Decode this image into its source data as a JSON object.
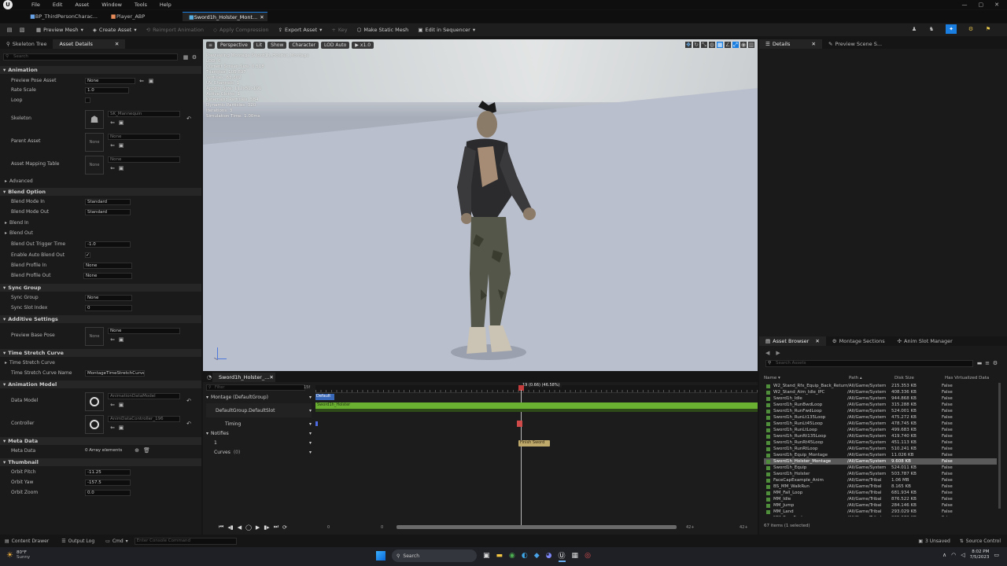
{
  "menu": [
    "File",
    "Edit",
    "Asset",
    "Window",
    "Tools",
    "Help"
  ],
  "doc_tabs": [
    {
      "label": "BP_ThirdPersonCharac...",
      "active": false
    },
    {
      "label": "Player_ABP",
      "active": false
    },
    {
      "label": "Sword1h_Holster_Mont...",
      "active": true
    }
  ],
  "toolbar": {
    "preview_mesh": "Preview Mesh",
    "create_asset": "Create Asset",
    "reimport": "Reimport Animation",
    "apply_compression": "Apply Compression",
    "export_asset": "Export Asset",
    "key": "Key",
    "make_static_mesh": "Make Static Mesh",
    "edit_in_sequencer": "Edit in Sequencer"
  },
  "left_tabs": {
    "skeleton_tree": "Skeleton Tree",
    "asset_details": "Asset Details"
  },
  "search_placeholder": "Search",
  "details": {
    "animation": "Animation",
    "preview_pose_asset": "Preview Pose Asset",
    "preview_pose_val": "None",
    "rate_scale": "Rate Scale",
    "rate_scale_val": "1.0",
    "loop": "Loop",
    "skeleton": "Skeleton",
    "skeleton_val": "SK_Mannequin",
    "parent_asset": "Parent Asset",
    "parent_val": "None",
    "parent_thumb": "None",
    "asset_mapping": "Asset Mapping Table",
    "mapping_val": "None",
    "mapping_thumb": "None",
    "advanced": "Advanced",
    "blend_option": "Blend Option",
    "blend_mode_in": "Blend Mode In",
    "blend_mode_in_val": "Standard",
    "blend_mode_out": "Blend Mode Out",
    "blend_mode_out_val": "Standard",
    "blend_in": "Blend In",
    "blend_out": "Blend Out",
    "blend_out_trigger": "Blend Out Trigger Time",
    "blend_out_trigger_val": "-1.0",
    "enable_auto_blend_out": "Enable Auto Blend Out",
    "blend_profile_in": "Blend Profile In",
    "blend_profile_in_val": "None",
    "blend_profile_out": "Blend Profile Out",
    "blend_profile_out_val": "None",
    "sync_group_hdr": "Sync Group",
    "sync_group": "Sync Group",
    "sync_group_val": "None",
    "sync_slot": "Sync Slot Index",
    "sync_slot_val": "0",
    "additive": "Additive Settings",
    "preview_base_pose": "Preview Base Pose",
    "preview_base_val": "None",
    "preview_base_thumb": "None",
    "time_stretch": "Time Stretch Curve",
    "time_stretch_sub": "Time Stretch Curve",
    "time_stretch_name": "Time Stretch Curve Name",
    "time_stretch_name_val": "MontageTimeStretchCurve",
    "anim_model": "Animation Model",
    "data_model": "Data Model",
    "data_model_val": "AnimationDataModel",
    "controller": "Controller",
    "controller_val": "AnimDataController_196",
    "meta_data_hdr": "Meta Data",
    "meta_data": "Meta Data",
    "meta_data_val": "0 Array elements",
    "thumbnail": "Thumbnail",
    "orbit_pitch": "Orbit Pitch",
    "orbit_pitch_val": "-11.25",
    "orbit_yaw": "Orbit Yaw",
    "orbit_yaw_val": "-157.5",
    "orbit_zoom": "Orbit Zoom",
    "orbit_zoom_val": "0.0"
  },
  "viewport": {
    "perspective": "Perspective",
    "lit": "Lit",
    "show": "Show",
    "character": "Character",
    "lod": "LOD Auto",
    "speed": "x1.0",
    "stats": [
      "Previewing Montage Sword1h_Holster_Montage",
      "LOD: 0",
      "Current Screen Size: 0.518",
      "Triangles: 105,897",
      "Vertices: 63,602",
      "UV Channels: 1",
      "Approx Size: 112x51x191",
      "Active Cloths: 1",
      "Kinematic Particles: 584",
      "Dynamic Particles: 320",
      "Iterations: 3",
      "Simulation Time: 1.00ms"
    ]
  },
  "right_tabs": {
    "details": "Details",
    "preview_scene": "Preview Scene S..."
  },
  "montage": {
    "tab": "Sword1h_Holster_...",
    "filter": "Filter",
    "frames_start": "15f",
    "playhead": "19 (0.66) (46.58%)",
    "track_montage": "Montage (DefaultGroup)",
    "slot": "DefaultGroup.DefaultSlot",
    "default_label": "Default",
    "clip_label": "Sword1h_Holster",
    "timing": "Timing",
    "notifies": "Notifies",
    "notify_track": "1",
    "curves": "Curves",
    "curves_count": "(0)",
    "notify_name": "Finish Sword",
    "range_start": "0",
    "range_mid": "0",
    "range_end": "42+",
    "range_end2": "42+"
  },
  "asset_browser": {
    "tabs": [
      "Asset Browser",
      "Montage Sections",
      "Anim Slot Manager"
    ],
    "search_placeholder": "Search Assets",
    "columns": [
      "Name",
      "Path",
      "Disk Size",
      "Has Virtualized Data"
    ],
    "rows": [
      {
        "name": "W2_Stand_Rfx_Equip_Back_Return",
        "path": "/All/Game/System",
        "size": "215.353 KB",
        "virt": "False"
      },
      {
        "name": "W2_Stand_Aim_Idle_IPC",
        "path": "/All/Game/System",
        "size": "408.336 KB",
        "virt": "False"
      },
      {
        "name": "Sword1h_Idle",
        "path": "/All/Game/System",
        "size": "944.868 KB",
        "virt": "False"
      },
      {
        "name": "Sword1h_RunBwdLoop",
        "path": "/All/Game/System",
        "size": "315.288 KB",
        "virt": "False"
      },
      {
        "name": "Sword1h_RunFwdLoop",
        "path": "/All/Game/System",
        "size": "524.001 KB",
        "virt": "False"
      },
      {
        "name": "Sword1h_RunLt135Loop",
        "path": "/All/Game/System",
        "size": "475.272 KB",
        "virt": "False"
      },
      {
        "name": "Sword1h_RunLt45Loop",
        "path": "/All/Game/System",
        "size": "478.745 KB",
        "virt": "False"
      },
      {
        "name": "Sword1h_RunLtLoop",
        "path": "/All/Game/System",
        "size": "499.683 KB",
        "virt": "False"
      },
      {
        "name": "Sword1h_RunRt135Loop",
        "path": "/All/Game/System",
        "size": "419.740 KB",
        "virt": "False"
      },
      {
        "name": "Sword1h_RunRt45Loop",
        "path": "/All/Game/System",
        "size": "451.113 KB",
        "virt": "False"
      },
      {
        "name": "Sword1h_RunRtLoop",
        "path": "/All/Game/System",
        "size": "510.241 KB",
        "virt": "False"
      },
      {
        "name": "Sword1h_Equip_Montage",
        "path": "/All/Game/System",
        "size": "11.026 KB",
        "virt": "False"
      },
      {
        "name": "Sword1h_Holster_Montage",
        "path": "/All/Game/System",
        "size": "9.608 KB",
        "virt": "False"
      },
      {
        "name": "Sword1h_Equip",
        "path": "/All/Game/System",
        "size": "524.011 KB",
        "virt": "False"
      },
      {
        "name": "Sword1h_Holster",
        "path": "/All/Game/System",
        "size": "503.787 KB",
        "virt": "False"
      },
      {
        "name": "FaceCapExample_Anim",
        "path": "/All/Game/Tribal",
        "size": "1.06 MB",
        "virt": "False"
      },
      {
        "name": "BS_MM_WalkRun",
        "path": "/All/Game/Tribal",
        "size": "8.165 KB",
        "virt": "False"
      },
      {
        "name": "MM_Fall_Loop",
        "path": "/All/Game/Tribal",
        "size": "681.934 KB",
        "virt": "False"
      },
      {
        "name": "MM_Idle",
        "path": "/All/Game/Tribal",
        "size": "876.522 KB",
        "virt": "False"
      },
      {
        "name": "MM_Jump",
        "path": "/All/Game/Tribal",
        "size": "284.146 KB",
        "virt": "False"
      },
      {
        "name": "MM_Land",
        "path": "/All/Game/Tribal",
        "size": "293.029 KB",
        "virt": "False"
      },
      {
        "name": "MM_Run_Fwd",
        "path": "/All/Game/Tribal",
        "size": "265.373 KB",
        "virt": "False"
      }
    ],
    "status": "67 items (1 selected)"
  },
  "statusbar": {
    "content_drawer": "Content Drawer",
    "output_log": "Output Log",
    "cmd": "Cmd",
    "console_placeholder": "Enter Console Command",
    "unsaved": "3 Unsaved",
    "source_control": "Source Control"
  },
  "taskbar": {
    "weather_temp": "80°F",
    "weather_desc": "Sunny",
    "search": "Search",
    "time": "8:02 PM",
    "date": "7/5/2023"
  },
  "colors": {
    "accent": "#1a7ee0",
    "clip_green": "#6bb131",
    "notify": "#c0aa6b"
  }
}
